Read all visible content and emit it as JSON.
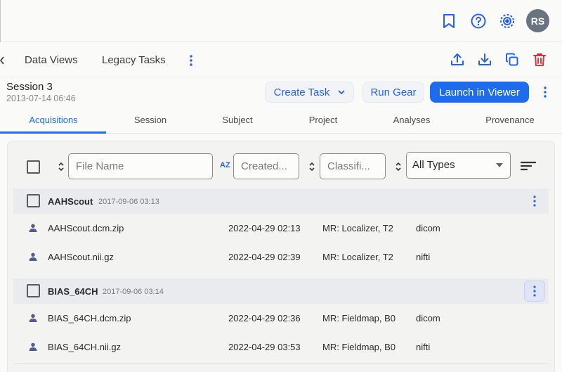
{
  "topbar": {
    "avatar_initials": "RS",
    "icons": [
      "bookmark-icon",
      "help-icon",
      "gear-target-icon"
    ]
  },
  "nav": {
    "tabs": [
      "Data Views",
      "Legacy Tasks"
    ],
    "actions": [
      "upload-icon",
      "download-icon",
      "copy-icon",
      "trash-icon"
    ]
  },
  "session": {
    "title": "Session 3",
    "date": "2013-07-14 06:46",
    "create_task": "Create Task",
    "run_gear": "Run Gear",
    "launch_viewer": "Launch in Viewer"
  },
  "tabs": [
    "Acquisitions",
    "Session",
    "Subject",
    "Project",
    "Analyses",
    "Provenance"
  ],
  "active_tab": "Acquisitions",
  "filters": {
    "file_name_placeholder": "File Name",
    "created_placeholder": "Created...",
    "classification_placeholder": "Classifi...",
    "type_value": "All Types",
    "az_label": "AZ"
  },
  "groups": [
    {
      "name": "AAHScout",
      "date": "2017-09-06 03:13",
      "files": [
        {
          "name": "AAHScout.dcm.zip",
          "created": "2022-04-29 02:13",
          "classification": "MR: Localizer, T2",
          "type": "dicom"
        },
        {
          "name": "AAHScout.nii.gz",
          "created": "2022-04-29 02:39",
          "classification": "MR: Localizer, T2",
          "type": "nifti"
        }
      ]
    },
    {
      "name": "BIAS_64CH",
      "date": "2017-09-06 03:14",
      "files": [
        {
          "name": "BIAS_64CH.dcm.zip",
          "created": "2022-04-29 02:36",
          "classification": "MR: Fieldmap, B0",
          "type": "dicom"
        },
        {
          "name": "BIAS_64CH.nii.gz",
          "created": "2022-04-29 03:53",
          "classification": "MR: Fieldmap, B0",
          "type": "nifti"
        }
      ]
    }
  ],
  "colors": {
    "accent": "#1f6bee",
    "danger": "#d9303b",
    "avatar": "#6a7380"
  }
}
